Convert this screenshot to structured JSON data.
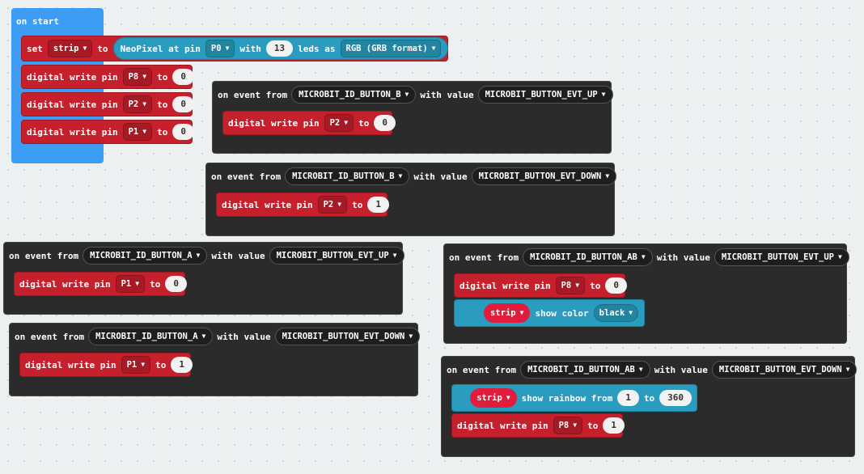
{
  "labels": {
    "on_start": "on start",
    "set": "set",
    "to": "to",
    "neopixel_at_pin": "NeoPixel at pin",
    "with": "with",
    "leds_as": "leds as",
    "digital_write_pin": "digital write pin",
    "on_event_from": "on event from",
    "with_value": "with value",
    "show_color": "show color",
    "show_rainbow_from": "show rainbow from"
  },
  "icons": {
    "dropdown": "dropdown-caret-icon"
  },
  "colors": {
    "start": "#3d9df5",
    "event": "#2b2b2b",
    "pins": "#c6202d",
    "neopixel": "#2a9cbf",
    "variable": "#e01d3c"
  },
  "on_start": {
    "variable": "strip",
    "pin": "P0",
    "leds": "13",
    "format": "RGB (GRB format)",
    "writes": [
      {
        "pin": "P8",
        "value": "0"
      },
      {
        "pin": "P2",
        "value": "0"
      },
      {
        "pin": "P1",
        "value": "0"
      }
    ]
  },
  "events": [
    {
      "source": "MICROBIT_ID_BUTTON_B",
      "value": "MICROBIT_BUTTON_EVT_UP",
      "pin": "P2",
      "write": "0"
    },
    {
      "source": "MICROBIT_ID_BUTTON_B",
      "value": "MICROBIT_BUTTON_EVT_DOWN",
      "pin": "P2",
      "write": "1"
    },
    {
      "source": "MICROBIT_ID_BUTTON_A",
      "value": "MICROBIT_BUTTON_EVT_UP",
      "pin": "P1",
      "write": "0"
    },
    {
      "source": "MICROBIT_ID_BUTTON_A",
      "value": "MICROBIT_BUTTON_EVT_DOWN",
      "pin": "P1",
      "write": "1"
    },
    {
      "source": "MICROBIT_ID_BUTTON_AB",
      "value": "MICROBIT_BUTTON_EVT_UP",
      "pin": "P8",
      "write": "0",
      "strip": "strip",
      "color": "black"
    },
    {
      "source": "MICROBIT_ID_BUTTON_AB",
      "value": "MICROBIT_BUTTON_EVT_DOWN",
      "pin": "P8",
      "write": "1",
      "strip": "strip",
      "rainbow_from": "1",
      "rainbow_to": "360"
    }
  ]
}
